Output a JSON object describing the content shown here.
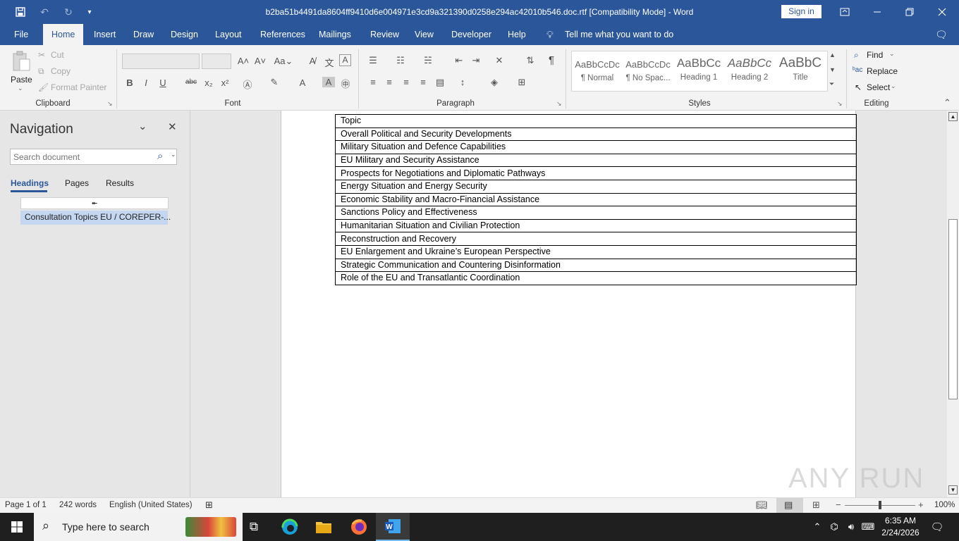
{
  "window": {
    "title": "b2ba51b4491da8604ff9410d6e004971e3cd9a321390d0258e294ac42010b546.doc.rtf [Compatibility Mode]  -  Word",
    "sign_in": "Sign in"
  },
  "tabs": [
    "File",
    "Home",
    "Insert",
    "Draw",
    "Design",
    "Layout",
    "References",
    "Mailings",
    "Review",
    "View",
    "Developer",
    "Help"
  ],
  "tell_me": "Tell me what you want to do",
  "clipboard": {
    "paste": "Paste",
    "cut": "Cut",
    "copy": "Copy",
    "format_painter": "Format Painter",
    "label": "Clipboard"
  },
  "font": {
    "label": "Font"
  },
  "paragraph": {
    "label": "Paragraph"
  },
  "styles": {
    "label": "Styles",
    "items": [
      {
        "preview": "AaBbCcDc",
        "name": "¶ Normal"
      },
      {
        "preview": "AaBbCcDc",
        "name": "¶ No Spac..."
      },
      {
        "preview": "AaBbCc",
        "name": "Heading 1"
      },
      {
        "preview": "AaBbCc",
        "name": "Heading 2"
      },
      {
        "preview": "AaBbC",
        "name": "Title"
      }
    ]
  },
  "editing": {
    "find": "Find",
    "replace": "Replace",
    "select": "Select",
    "label": "Editing"
  },
  "navigation": {
    "title": "Navigation",
    "search_placeholder": "Search document",
    "tabs": [
      "Headings",
      "Pages",
      "Results"
    ],
    "heading_item": "Consultation Topics EU / COREPER-..."
  },
  "table_rows": [
    "Topic",
    "Overall Political and Security Developments",
    "Military Situation and Defence Capabilities",
    "EU Military and Security Assistance",
    "Prospects for Negotiations and Diplomatic Pathways",
    "Energy Situation and Energy Security",
    "Economic Stability and Macro-Financial Assistance",
    "Sanctions Policy and Effectiveness",
    "Humanitarian Situation and Civilian Protection",
    "Reconstruction and Recovery",
    "EU Enlargement and Ukraine’s European Perspective",
    "Strategic Communication and Countering Disinformation",
    "Role of the EU and Transatlantic Coordination"
  ],
  "status": {
    "page": "Page 1 of 1",
    "words": "242 words",
    "language": "English (United States)",
    "zoom": "100%"
  },
  "taskbar": {
    "search_placeholder": "Type here to search",
    "time": "6:35 AM",
    "date": "2/24/2026"
  },
  "watermark": "ANY RUN"
}
